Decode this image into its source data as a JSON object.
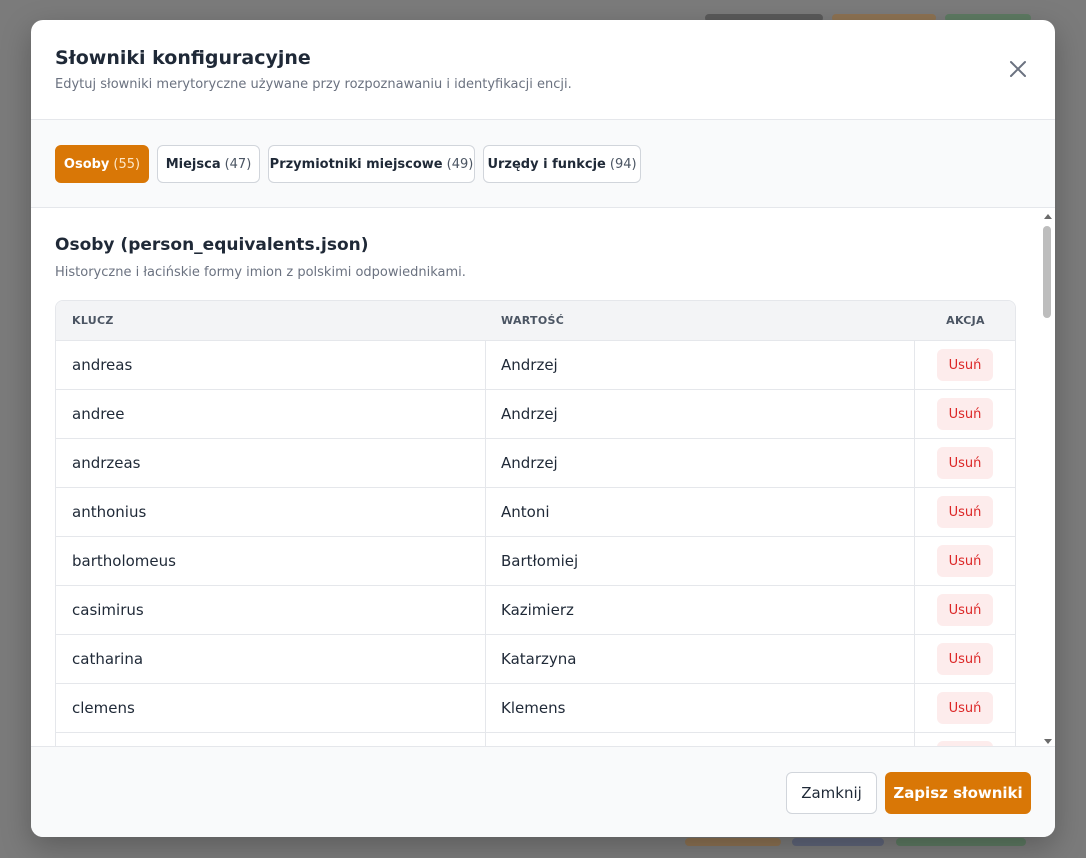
{
  "modal": {
    "title": "Słowniki konfiguracyjne",
    "subtitle": "Edytuj słowniki merytoryczne używane przy rozpoznawaniu i identyfikacji encji.",
    "close_icon": "close-icon"
  },
  "tabs": [
    {
      "label": "Osoby",
      "count": "(55)",
      "active": true
    },
    {
      "label": "Miejsca",
      "count": "(47)",
      "active": false
    },
    {
      "label": "Przymiotniki miejscowe",
      "count": "(49)",
      "active": false
    },
    {
      "label": "Urzędy i funkcje",
      "count": "(94)",
      "active": false
    }
  ],
  "section": {
    "title": "Osoby (person_equivalents.json)",
    "description": "Historyczne i łacińskie formy imion z polskimi odpowiednikami."
  },
  "table": {
    "headers": {
      "key": "KLUCZ",
      "value": "WARTOŚĆ",
      "action": "AKCJA"
    },
    "delete_label": "Usuń",
    "rows": [
      {
        "key": "andreas",
        "value": "Andrzej"
      },
      {
        "key": "andree",
        "value": "Andrzej"
      },
      {
        "key": "andrzeas",
        "value": "Andrzej"
      },
      {
        "key": "anthonius",
        "value": "Antoni"
      },
      {
        "key": "bartholomeus",
        "value": "Bartłomiej"
      },
      {
        "key": "casimirus",
        "value": "Kazimierz"
      },
      {
        "key": "catharina",
        "value": "Katarzyna"
      },
      {
        "key": "clemens",
        "value": "Klemens"
      },
      {
        "key": "",
        "value": ""
      }
    ]
  },
  "footer": {
    "close_label": "Zamknij",
    "save_label": "Zapisz słowniki"
  },
  "colors": {
    "accent": "#d97706",
    "danger": "#dc2626",
    "danger_bg": "#fdecec"
  }
}
